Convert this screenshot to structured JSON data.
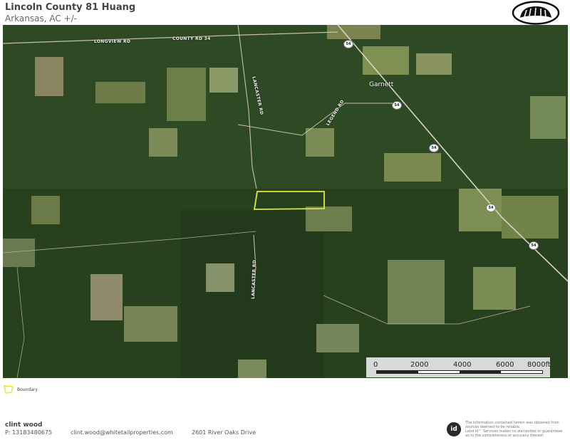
{
  "header": {
    "title": "Lincoln County 81 Huang",
    "subtitle": "Arkansas,  AC +/-",
    "logo_icon": "bear-paw-logo"
  },
  "map": {
    "road_labels": {
      "longview": "LONGVIEW RD",
      "county34": "COUNTY RD 34",
      "lancaster_north": "LANCASTER RD",
      "legend_rd": "LEGEND RD",
      "lancaster_south": "LANCASTER RD"
    },
    "town": "Garnett",
    "highway_shields": [
      "54",
      "54",
      "54",
      "54",
      "54"
    ],
    "boundary_color": "#e6e635",
    "scale": {
      "labels": [
        "0",
        "2000",
        "4000",
        "6000",
        "8000ft"
      ]
    }
  },
  "legend": {
    "boundary_label": "Boundary",
    "boundary_color": "#e6e635"
  },
  "agent": {
    "name": "clint wood",
    "phone": "P: 13183480675",
    "email": "clint.wood@whitetailproperties.com",
    "address": "2601 River Oaks Drive"
  },
  "footer": {
    "badge": "id",
    "disclaimer": [
      "The information contained herein was obtained from",
      "sources deemed to be reliable.",
      "Land id™ Services makes no warranties or guarantees",
      "as to the completeness or accuracy thereof."
    ]
  }
}
